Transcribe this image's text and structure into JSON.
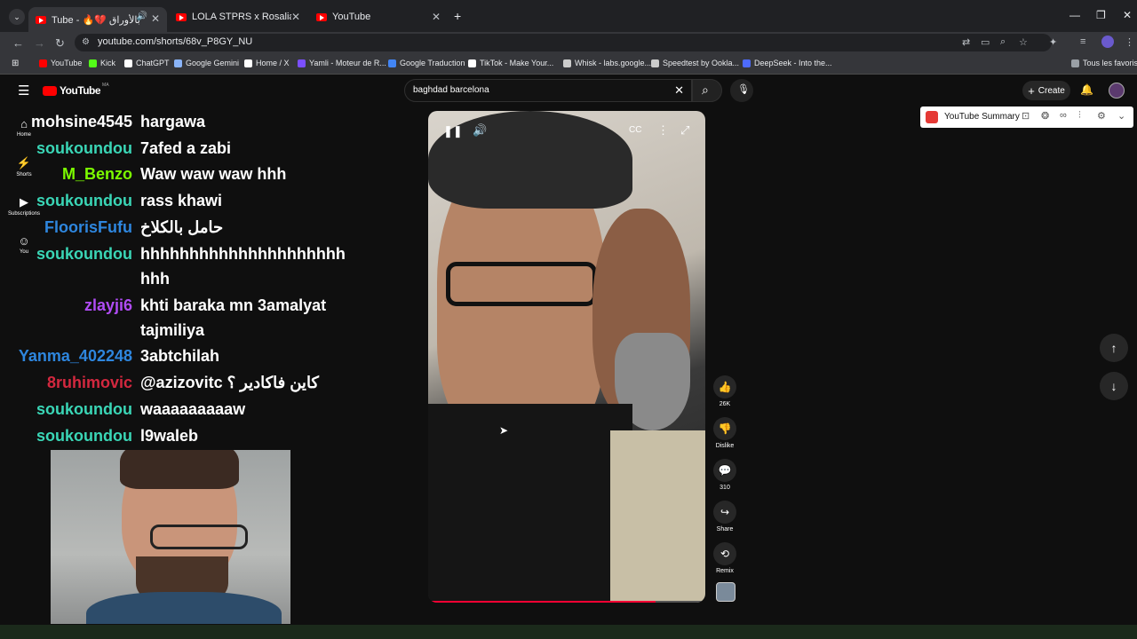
{
  "browser": {
    "tabs": [
      {
        "label": "Tube - 🔥💔 كل شي بالأوراق"
      },
      {
        "label": "LOLA STPRS x Rosalia BAGDAD"
      },
      {
        "label": "YouTube"
      }
    ],
    "new_tab": "+",
    "url": "youtube.com/shorts/68v_P8GY_NU",
    "bookmarks": [
      {
        "label": "YouTube",
        "color": "#ff0000"
      },
      {
        "label": "Kick",
        "color": "#53fc18"
      },
      {
        "label": "ChatGPT",
        "color": "#ffffff"
      },
      {
        "label": "Google Gemini",
        "color": "#8ab4f8"
      },
      {
        "label": "Home / X",
        "color": "#ffffff"
      },
      {
        "label": "Yamli - Moteur de R...",
        "color": "#7b4fff"
      },
      {
        "label": "Google Traduction",
        "color": "#4285f4"
      },
      {
        "label": "TikTok - Make Your...",
        "color": "#ffffff"
      },
      {
        "label": "Whisk - labs.google...",
        "color": "#cccccc"
      },
      {
        "label": "Speedtest by Ookla...",
        "color": "#cccccc"
      },
      {
        "label": "DeepSeek - Into the...",
        "color": "#4d6bfe"
      }
    ],
    "all_bookmarks": "Tous les favoris"
  },
  "youtube": {
    "logo": "YouTube",
    "logo_region": "MA",
    "search_value": "baghdad barcelona",
    "create_label": "Create",
    "sidebar": [
      {
        "label": "Home"
      },
      {
        "label": "Shorts"
      },
      {
        "label": "Subscriptions"
      },
      {
        "label": "You"
      }
    ],
    "actions": [
      {
        "label": "26K"
      },
      {
        "label": "Dislike"
      },
      {
        "label": "310"
      },
      {
        "label": "Share"
      },
      {
        "label": "Remix"
      }
    ],
    "video_progress": 0.82
  },
  "extension": {
    "label": "YouTube Summary"
  },
  "chat": [
    {
      "user": "mohsine4545",
      "color": "#ffffff",
      "msg": "hargawa"
    },
    {
      "user": "soukoundou",
      "color": "#3ad6b6",
      "msg": "7afed a zabi"
    },
    {
      "user": "M_Benzo",
      "color": "#7cfc00",
      "msg": "Waw waw waw hhh"
    },
    {
      "user": "soukoundou",
      "color": "#3ad6b6",
      "msg": "rass khawi"
    },
    {
      "user": "FloorisFufu",
      "color": "#2e86de",
      "msg": "حامل بالكلاخ"
    },
    {
      "user": "soukoundou",
      "color": "#3ad6b6",
      "msg": "hhhhhhhhhhhhhhhhhhhhh",
      "msg2": "hhh"
    },
    {
      "user": "zlayji6",
      "color": "#b04cf5",
      "msg": "khti baraka mn 3amalyat",
      "msg2": "tajmiliya"
    },
    {
      "user": "Yanma_402248",
      "color": "#2e86de",
      "msg": "3abtchilah"
    },
    {
      "user": "8ruhimovic",
      "color": "#d3283f",
      "msg": "@azizovitc كاين فاكادير ؟"
    },
    {
      "user": "soukoundou",
      "color": "#3ad6b6",
      "msg": "waaaaaaaaaw"
    },
    {
      "user": "soukoundou",
      "color": "#3ad6b6",
      "msg": "l9waleb"
    }
  ]
}
